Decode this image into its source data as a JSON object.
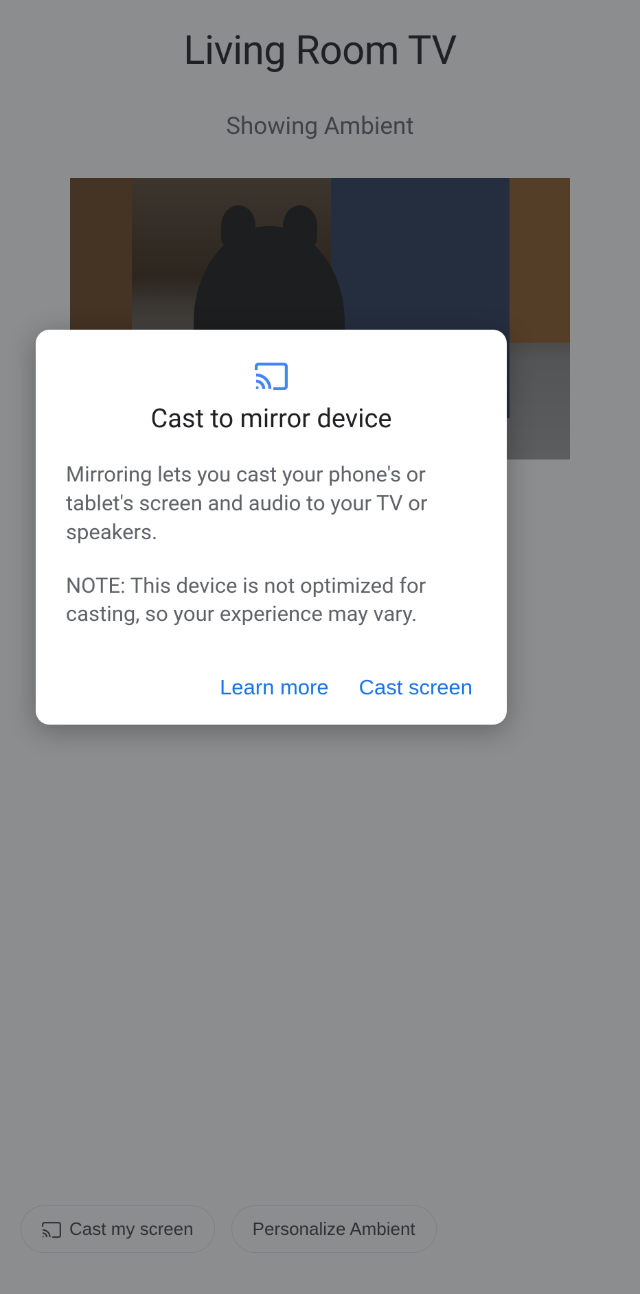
{
  "header": {
    "title": "Living Room TV",
    "subtitle": "Showing Ambient"
  },
  "bottom_bar": {
    "cast_button": "Cast my screen",
    "personalize_button": "Personalize Ambient"
  },
  "dialog": {
    "title": "Cast to mirror device",
    "paragraph1": "Mirroring lets you cast your phone's or tablet's screen and audio to your TV or speakers.",
    "paragraph2": "NOTE: This device is not optimized for casting, so your experience may vary.",
    "learn_more": "Learn more",
    "cast_screen": "Cast screen"
  }
}
